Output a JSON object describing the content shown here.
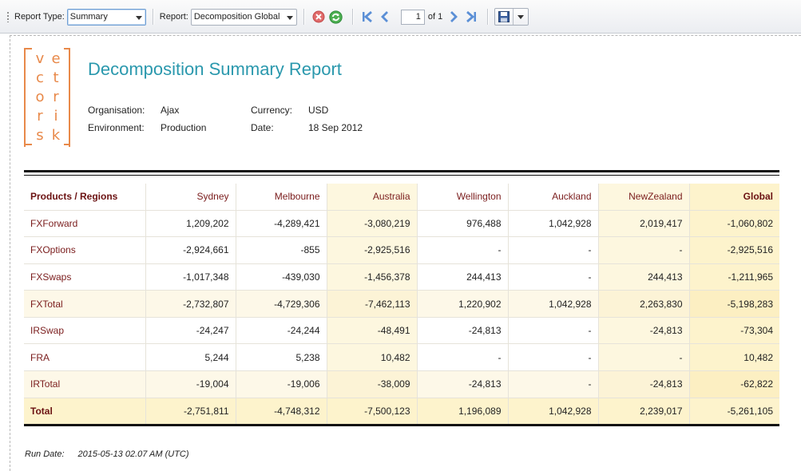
{
  "toolbar": {
    "report_type_label": "Report Type:",
    "report_type_value": "Summary",
    "report_label": "Report:",
    "report_value": "Decomposition Global",
    "page_number": "1",
    "page_of": "of 1"
  },
  "logo": {
    "letters": [
      "v",
      "e",
      "c",
      "t",
      "o",
      "r",
      "r",
      "i",
      "s",
      "k"
    ]
  },
  "header": {
    "title": "Decomposition Summary Report",
    "organisation_label": "Organisation:",
    "organisation_value": "Ajax",
    "environment_label": "Environment:",
    "environment_value": "Production",
    "currency_label": "Currency:",
    "currency_value": "USD",
    "date_label": "Date:",
    "date_value": "18 Sep 2012"
  },
  "table": {
    "columns": [
      "Products / Regions",
      "Sydney",
      "Melbourne",
      "Australia",
      "Wellington",
      "Auckland",
      "NewZealand",
      "Global"
    ],
    "rows": [
      {
        "label": "FXForward",
        "values": [
          "1,209,202",
          "-4,289,421",
          "-3,080,219",
          "976,488",
          "1,042,928",
          "2,019,417",
          "-1,060,802"
        ]
      },
      {
        "label": "FXOptions",
        "values": [
          "-2,924,661",
          "-855",
          "-2,925,516",
          "-",
          "-",
          "-",
          "-2,925,516"
        ]
      },
      {
        "label": "FXSwaps",
        "values": [
          "-1,017,348",
          "-439,030",
          "-1,456,378",
          "244,413",
          "-",
          "244,413",
          "-1,211,965"
        ]
      },
      {
        "label": "FXTotal",
        "values": [
          "-2,732,807",
          "-4,729,306",
          "-7,462,113",
          "1,220,902",
          "1,042,928",
          "2,263,830",
          "-5,198,283"
        ]
      },
      {
        "label": "IRSwap",
        "values": [
          "-24,247",
          "-24,244",
          "-48,491",
          "-24,813",
          "-",
          "-24,813",
          "-73,304"
        ]
      },
      {
        "label": "FRA",
        "values": [
          "5,244",
          "5,238",
          "10,482",
          "-",
          "-",
          "-",
          "10,482"
        ]
      },
      {
        "label": "IRTotal",
        "values": [
          "-19,004",
          "-19,006",
          "-38,009",
          "-24,813",
          "-",
          "-24,813",
          "-62,822"
        ]
      },
      {
        "label": "Total",
        "values": [
          "-2,751,811",
          "-4,748,312",
          "-7,500,123",
          "1,196,089",
          "1,042,928",
          "2,239,017",
          "-5,261,105"
        ]
      }
    ]
  },
  "footer": {
    "run_date_label": "Run Date:",
    "run_date_value": "2015-05-13 02.07 AM (UTC)"
  },
  "colors": {
    "title": "#2a98ad",
    "logo": "#e8894a",
    "header_text": "#7a1c1c",
    "country_col_bg": "#fdf7df",
    "global_col_bg": "#fdf3cc"
  }
}
